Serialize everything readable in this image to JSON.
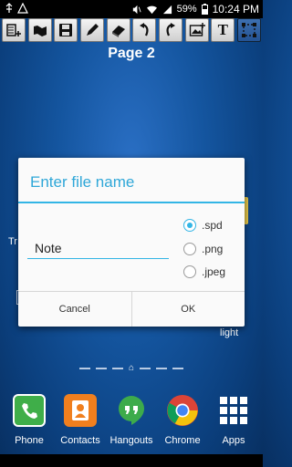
{
  "status_bar": {
    "battery": "59%",
    "time": "10:24 PM"
  },
  "toolbar": {
    "items": [
      {
        "name": "add-page-icon"
      },
      {
        "name": "open-folder-icon"
      },
      {
        "name": "save-icon"
      },
      {
        "name": "pen-icon"
      },
      {
        "name": "eraser-icon"
      },
      {
        "name": "undo-icon"
      },
      {
        "name": "redo-icon"
      },
      {
        "name": "image-icon"
      },
      {
        "name": "text-icon",
        "label": "T"
      },
      {
        "name": "select-icon",
        "active": true
      }
    ]
  },
  "page": {
    "title": "Page 2"
  },
  "background": {
    "left_fragment": "Tr",
    "right_fragment": "light"
  },
  "dialog": {
    "title": "Enter file name",
    "input_value": "Note",
    "options": [
      {
        "label": ".spd",
        "selected": true
      },
      {
        "label": ".png",
        "selected": false
      },
      {
        "label": ".jpeg",
        "selected": false
      }
    ],
    "cancel_label": "Cancel",
    "ok_label": "OK"
  },
  "dock": {
    "items": [
      {
        "label": "Phone",
        "icon": "phone-icon"
      },
      {
        "label": "Contacts",
        "icon": "contacts-icon"
      },
      {
        "label": "Hangouts",
        "icon": "hangouts-icon"
      },
      {
        "label": "Chrome",
        "icon": "chrome-icon"
      },
      {
        "label": "Apps",
        "icon": "apps-grid-icon"
      }
    ]
  },
  "colors": {
    "accent": "#33b5e5",
    "title_blue": "#2fa7d8"
  }
}
